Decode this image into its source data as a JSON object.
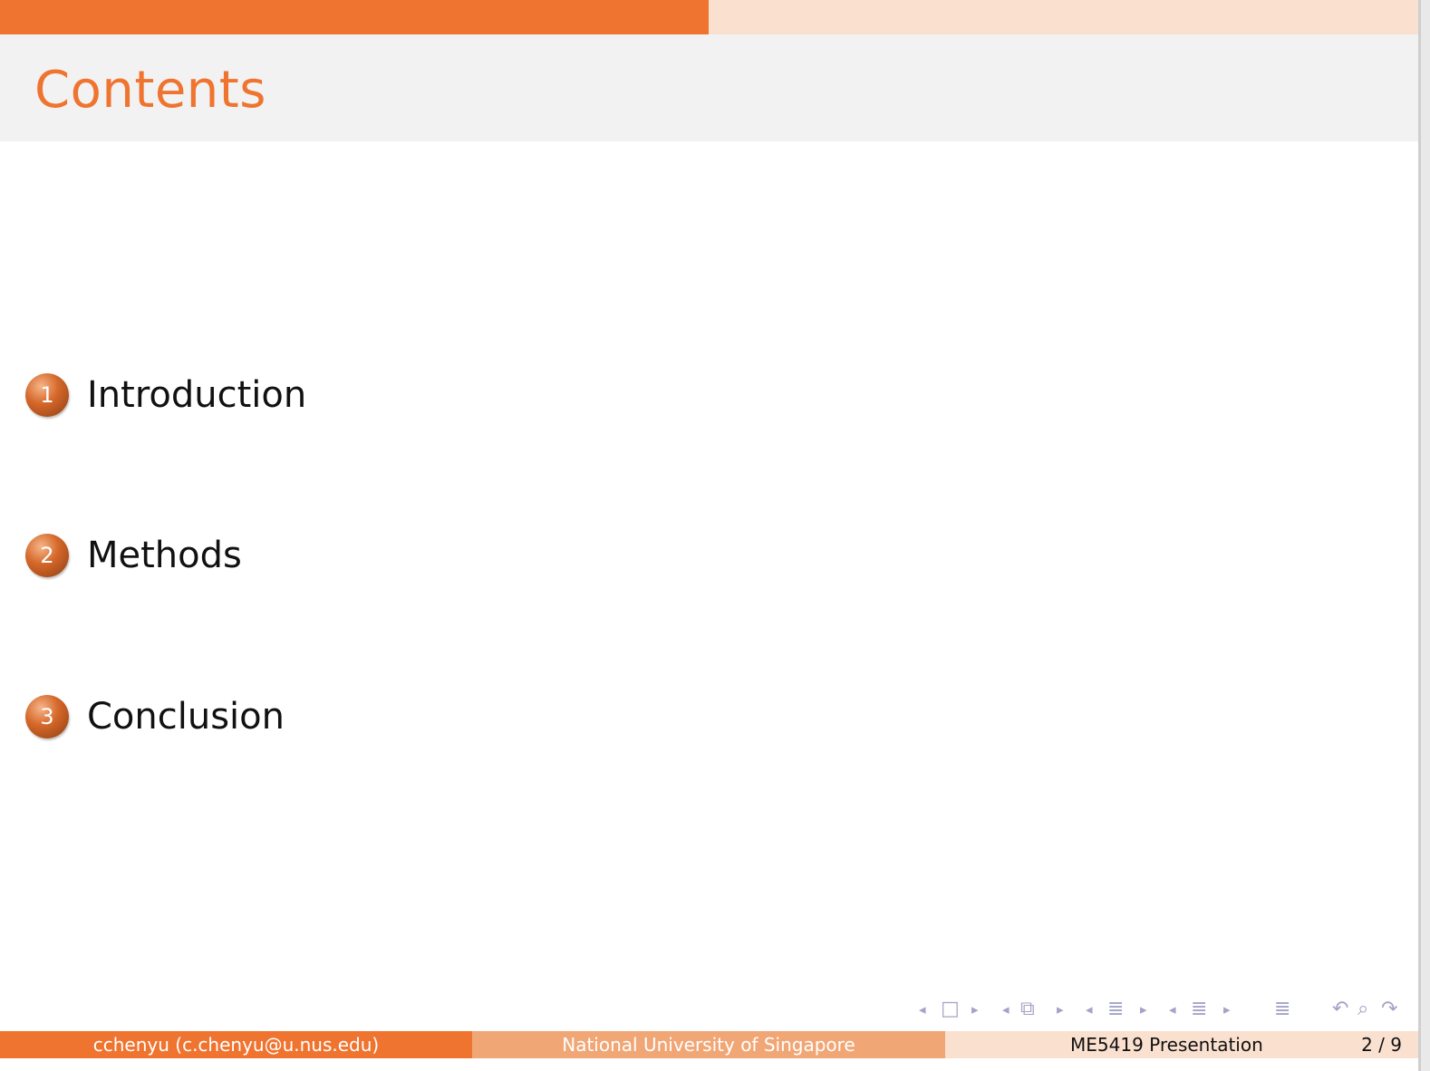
{
  "slide": {
    "title": "Contents"
  },
  "toc": [
    {
      "number": "1",
      "label": "Introduction"
    },
    {
      "number": "2",
      "label": "Methods"
    },
    {
      "number": "3",
      "label": "Conclusion"
    }
  ],
  "footer": {
    "author": "cchenyu  (c.chenyu@u.nus.edu)",
    "institution": "National University of Singapore",
    "presentation": "ME5419 Presentation",
    "page": "2 / 9"
  },
  "theme": {
    "accent": "#ef7430",
    "accent_light": "#f1a675",
    "accent_pale": "#fae0cf",
    "nav_icon_color": "#a3a3c8"
  },
  "nav_icons": [
    "frame-prev-icon",
    "frame-icon",
    "frame-next-icon",
    "subsection-prev-icon",
    "subsection-icon",
    "subsection-next-icon",
    "section-prev-icon",
    "section-icon",
    "section-next-icon",
    "slide-prev-icon",
    "slide-icon",
    "slide-next-icon",
    "outline-icon",
    "back-icon",
    "search-icon",
    "forward-icon"
  ]
}
